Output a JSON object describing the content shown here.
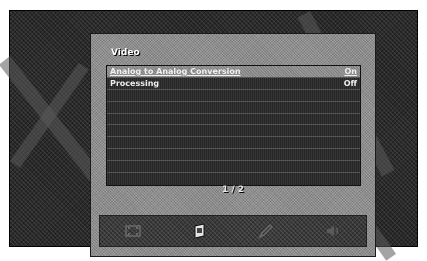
{
  "menu": {
    "title": "Video",
    "items": [
      {
        "label": "Analog to Analog Conversion",
        "value": "On"
      },
      {
        "label": "Processing",
        "value": "Off"
      },
      {
        "label": "",
        "value": ""
      },
      {
        "label": "",
        "value": ""
      },
      {
        "label": "",
        "value": ""
      },
      {
        "label": "",
        "value": ""
      },
      {
        "label": "",
        "value": ""
      },
      {
        "label": "",
        "value": ""
      },
      {
        "label": "",
        "value": ""
      },
      {
        "label": "",
        "value": ""
      }
    ],
    "page_indicator": "1 / 2"
  },
  "iconbar": {
    "icons": [
      "film-icon",
      "video-settings-icon",
      "pencil-icon",
      "speaker-icon"
    ],
    "active": "video-settings-icon"
  }
}
